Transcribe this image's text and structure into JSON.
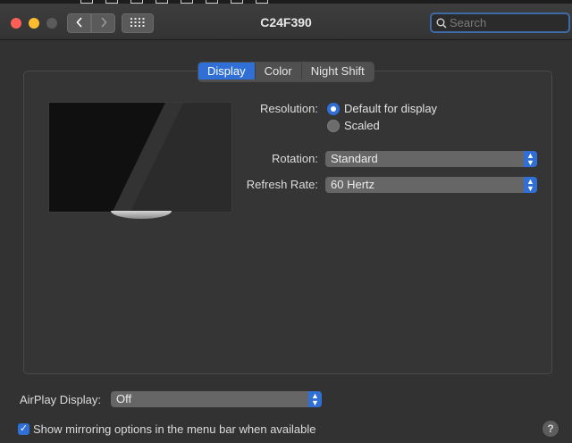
{
  "window": {
    "title": "C24F390",
    "search_placeholder": "Search"
  },
  "tabs": [
    {
      "label": "Display",
      "active": true
    },
    {
      "label": "Color",
      "active": false
    },
    {
      "label": "Night Shift",
      "active": false
    }
  ],
  "resolution": {
    "label": "Resolution:",
    "options": [
      {
        "label": "Default for display",
        "selected": true
      },
      {
        "label": "Scaled",
        "selected": false
      }
    ]
  },
  "rotation": {
    "label": "Rotation:",
    "value": "Standard"
  },
  "refresh_rate": {
    "label": "Refresh Rate:",
    "value": "60 Hertz"
  },
  "airplay": {
    "label": "AirPlay Display:",
    "value": "Off"
  },
  "mirroring": {
    "label": "Show mirroring options in the menu bar when available",
    "checked": true
  },
  "help": {
    "glyph": "?"
  },
  "colors": {
    "accent": "#2f6fd6",
    "window_bg": "#323232"
  }
}
